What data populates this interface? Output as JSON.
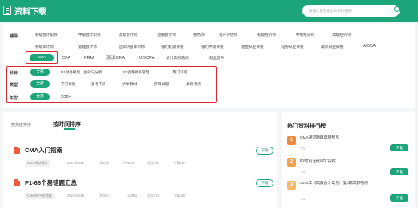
{
  "header": {
    "title": "资料下载",
    "search_placeholder": "请输入需要搜索的资料名称"
  },
  "filters": {
    "row1_label": "辅导:",
    "row1": [
      "初级会计职称",
      "中级会计职称",
      "高级会计师",
      "注册会计师",
      "税务师",
      "资产评估师",
      "初级经济师",
      "中级经济师",
      "高级经济师"
    ],
    "row2": [
      "初级审计师",
      "管理会计师",
      "国际内部审计师",
      "银行初级资格",
      "银行中级资格",
      "基金从业资格",
      "证券从业资格",
      "期货从业资格",
      "ACCA"
    ],
    "row3": [
      "CMA",
      "CFA",
      "FRM",
      "澳洲CPA",
      "USCPA",
      "会计实务培训",
      "就业晋升"
    ],
    "row3_selected": "CMA",
    "subject_label": "科目:",
    "subject_all": "全部",
    "subjects": [
      "P1财务规划、绩效与分析",
      "P2战略财务管理",
      "两门科目"
    ],
    "type_label": "类型:",
    "type_all": "全部",
    "types": [
      "学习计划",
      "备考干货",
      "大纲教材",
      "历年试题",
      "高频考点"
    ],
    "year_label": "年份:",
    "year_all": "全部",
    "years": [
      "2024"
    ]
  },
  "list": {
    "tab_latest": "按热度排序",
    "tab_hot": "按时间排序",
    "items": [
      {
        "title": "CMA入门指南",
        "tag": "CMA考试简介",
        "date": "2024/06/22",
        "pages": "共20页",
        "size": "7.72MB",
        "views": "浏览711",
        "downloads": "下载587",
        "button": "下载"
      },
      {
        "title": "P1-66个易错题汇总",
        "tag": "CMA66个易错题",
        "date": "2024/06/19",
        "pages": "共30页",
        "size": "1.2MB",
        "views": "浏览742",
        "downloads": "下载359",
        "button": "下载"
      }
    ]
  },
  "ranking": {
    "title": "热门资料排行榜",
    "items": [
      {
        "num": "1",
        "name": "CMA随堂题目高频考点",
        "count": "771",
        "button": "下载",
        "color": "#f08a3c"
      },
      {
        "num": "2",
        "name": "P2考前狂背50个公式",
        "count": "735",
        "button": "下载",
        "color": "#f4a14d"
      },
      {
        "num": "3",
        "name": "2024年《高级会计实务》第1期高频考点",
        "count": "702",
        "button": "下载",
        "color": "#f8b867"
      }
    ]
  }
}
